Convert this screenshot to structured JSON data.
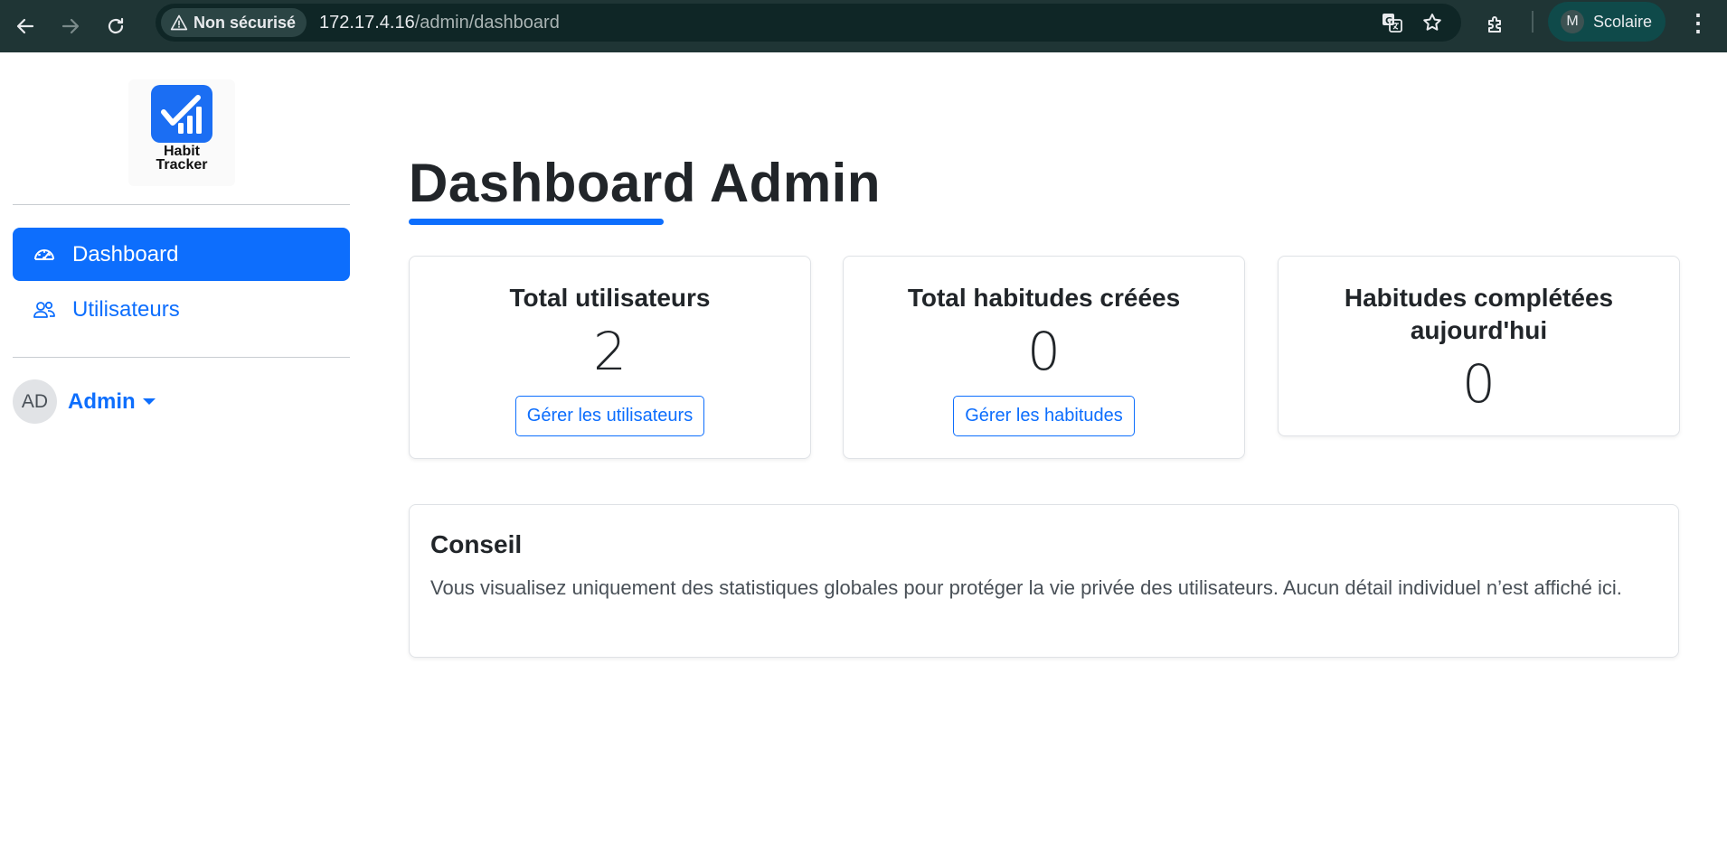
{
  "browser": {
    "security_label": "Non sécurisé",
    "url_host": "172.17.4.16",
    "url_path": "/admin/dashboard",
    "profile_initial": "M",
    "profile_name": "Scolaire"
  },
  "sidebar": {
    "logo_line1": "Habit",
    "logo_line2": "Tracker",
    "nav": [
      {
        "label": "Dashboard",
        "icon": "speedometer-icon",
        "active": true
      },
      {
        "label": "Utilisateurs",
        "icon": "people-icon",
        "active": false
      }
    ],
    "user": {
      "initials": "AD",
      "name": "Admin"
    }
  },
  "main": {
    "title": "Dashboard Admin",
    "cards": [
      {
        "title": "Total utilisateurs",
        "value": "2",
        "button": "Gérer les utilisateurs"
      },
      {
        "title": "Total habitudes créées",
        "value": "0",
        "button": "Gérer les habitudes"
      },
      {
        "title": "Habitudes complétées aujourd'hui",
        "value": "0"
      }
    ],
    "tip": {
      "title": "Conseil",
      "text": "Vous visualisez uniquement des statistiques globales pour protéger la vie privée des utilisateurs. Aucun détail individuel n’est affiché ici."
    }
  },
  "colors": {
    "accent": "#0d6efd",
    "chrome": "#1f3535"
  }
}
